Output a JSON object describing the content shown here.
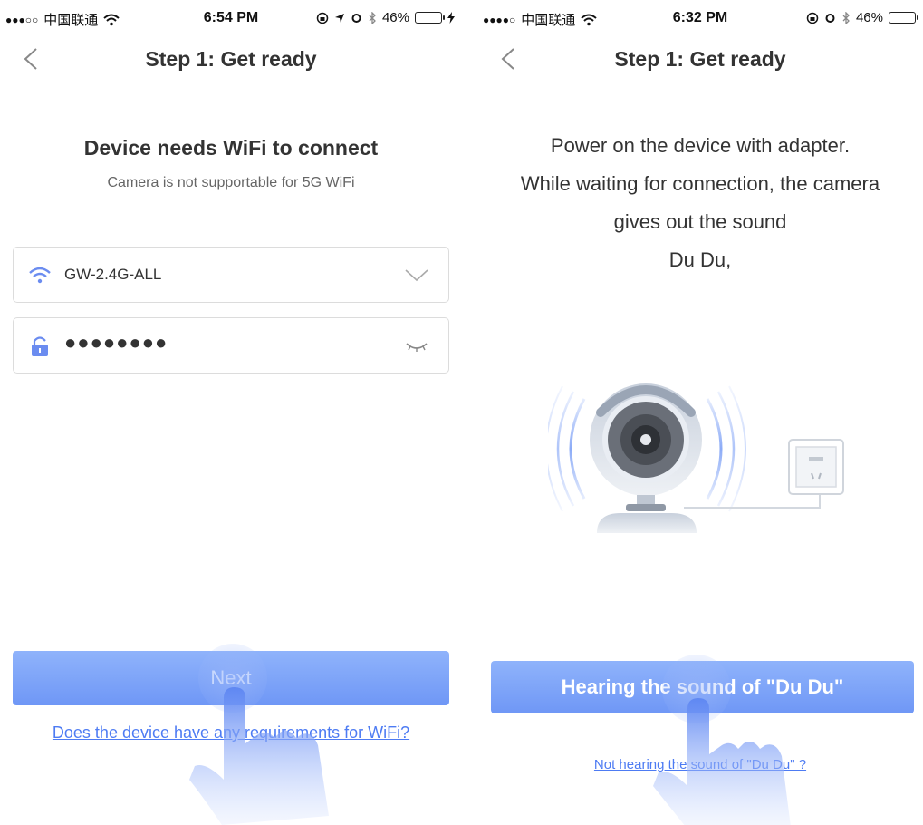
{
  "left": {
    "status": {
      "signal": "●●●○○",
      "carrier": "中国联通",
      "time": "6:54 PM",
      "battery_percent": "46%",
      "battery_level": 0.46,
      "battery_color": "#4cd964"
    },
    "nav": {
      "title": "Step 1: Get ready"
    },
    "headline": "Device needs WiFi to connect",
    "subline": "Camera is not supportable for 5G WiFi",
    "wifi_field": {
      "icon": "wifi-icon",
      "value": "GW-2.4G-ALL",
      "trailing_icon": "chevron-down-icon"
    },
    "password_field": {
      "icon": "lock-icon",
      "value": "●●●●●●●●",
      "trailing_icon": "eye-closed-icon"
    },
    "next_button": "Next",
    "wifi_requirements_link": "Does the device have any requirements for WiFi?"
  },
  "right": {
    "status": {
      "signal": "●●●●○",
      "carrier": "中国联通",
      "time": "6:32 PM",
      "battery_percent": "46%",
      "battery_level": 0.46,
      "battery_color": "#111111"
    },
    "nav": {
      "title": "Step 1: Get ready"
    },
    "instructions": [
      "Power on the device with adapter.",
      "While waiting for connection, the camera",
      "gives out the sound",
      "Du Du,"
    ],
    "hearing_button": "Hearing the sound of \"Du Du\"",
    "not_hearing_link": "Not hearing the sound of \"Du Du\" ?"
  },
  "colors": {
    "accent": "#6f97f6",
    "link": "#4d7bf3",
    "icon_blue": "#6b8cf0"
  }
}
